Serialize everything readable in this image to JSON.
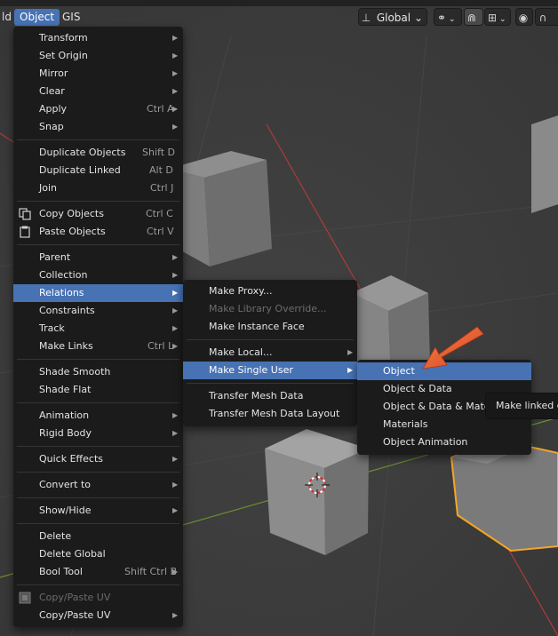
{
  "header": {
    "tabs": [
      {
        "label": "ld"
      },
      {
        "label": "Object"
      },
      {
        "label": "GIS"
      }
    ],
    "orientation_label": "Global"
  },
  "object_menu": {
    "items": [
      {
        "label": "Transform",
        "shortcut": ""
      },
      {
        "label": "Set Origin",
        "shortcut": ""
      },
      {
        "label": "Mirror",
        "shortcut": ""
      },
      {
        "label": "Clear",
        "shortcut": ""
      },
      {
        "label": "Apply",
        "shortcut": "Ctrl A"
      },
      {
        "label": "Snap",
        "shortcut": ""
      },
      {
        "label": "Duplicate Objects",
        "shortcut": "Shift D"
      },
      {
        "label": "Duplicate Linked",
        "shortcut": "Alt D"
      },
      {
        "label": "Join",
        "shortcut": "Ctrl J"
      },
      {
        "label": "Copy Objects",
        "shortcut": "Ctrl C"
      },
      {
        "label": "Paste Objects",
        "shortcut": "Ctrl V"
      },
      {
        "label": "Parent",
        "shortcut": ""
      },
      {
        "label": "Collection",
        "shortcut": ""
      },
      {
        "label": "Relations",
        "shortcut": ""
      },
      {
        "label": "Constraints",
        "shortcut": ""
      },
      {
        "label": "Track",
        "shortcut": ""
      },
      {
        "label": "Make Links",
        "shortcut": "Ctrl L"
      },
      {
        "label": "Shade Smooth",
        "shortcut": ""
      },
      {
        "label": "Shade Flat",
        "shortcut": ""
      },
      {
        "label": "Animation",
        "shortcut": ""
      },
      {
        "label": "Rigid Body",
        "shortcut": ""
      },
      {
        "label": "Quick Effects",
        "shortcut": ""
      },
      {
        "label": "Convert to",
        "shortcut": ""
      },
      {
        "label": "Show/Hide",
        "shortcut": ""
      },
      {
        "label": "Delete",
        "shortcut": ""
      },
      {
        "label": "Delete Global",
        "shortcut": ""
      },
      {
        "label": "Bool Tool",
        "shortcut": "Shift Ctrl B"
      },
      {
        "label": "Copy/Paste UV",
        "shortcut": ""
      },
      {
        "label": "Copy/Paste UV",
        "shortcut": ""
      }
    ]
  },
  "relations_menu": {
    "items": [
      {
        "label": "Make Proxy..."
      },
      {
        "label": "Make Library Override..."
      },
      {
        "label": "Make Instance Face"
      },
      {
        "label": "Make Local..."
      },
      {
        "label": "Make Single User"
      },
      {
        "label": "Transfer Mesh Data"
      },
      {
        "label": "Transfer Mesh Data Layout"
      }
    ]
  },
  "single_user_menu": {
    "items": [
      {
        "label": "Object"
      },
      {
        "label": "Object & Data"
      },
      {
        "label": "Object & Data & Mater"
      },
      {
        "label": "Materials"
      },
      {
        "label": "Object Animation"
      }
    ]
  },
  "tooltip": {
    "text": "Make linked d"
  },
  "colors": {
    "highlight": "#4772b3",
    "menu_bg": "#1b1b1b",
    "selection_outline": "#f5a623",
    "annotation_arrow": "#e8522a"
  }
}
